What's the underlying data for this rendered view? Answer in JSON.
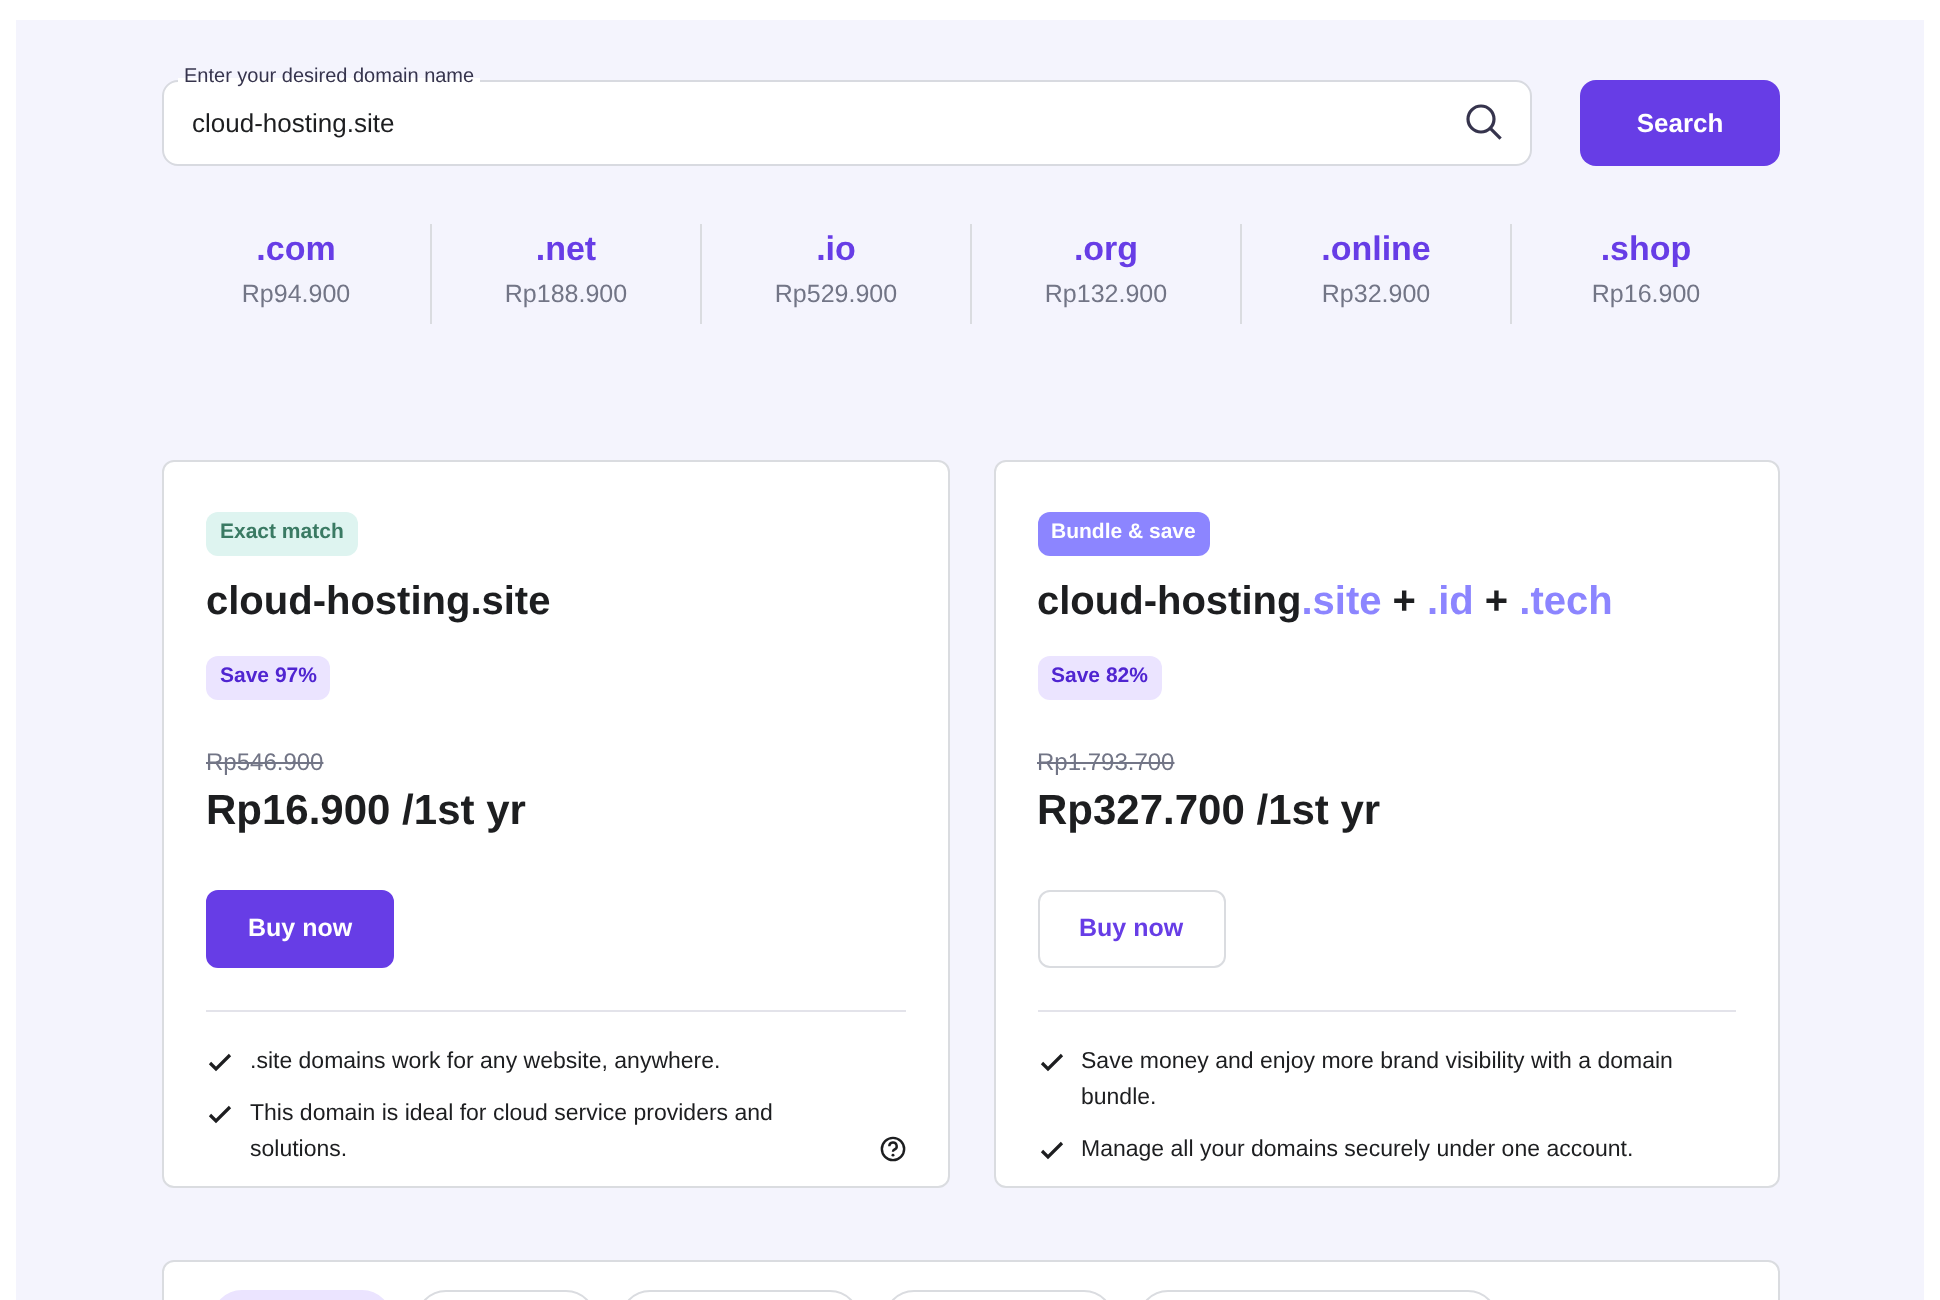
{
  "search": {
    "label": "Enter your desired domain name",
    "value": "cloud-hosting.site",
    "button": "Search"
  },
  "tlds": [
    {
      "name": ".com",
      "price": "Rp94.900"
    },
    {
      "name": ".net",
      "price": "Rp188.900"
    },
    {
      "name": ".io",
      "price": "Rp529.900"
    },
    {
      "name": ".org",
      "price": "Rp132.900"
    },
    {
      "name": ".online",
      "price": "Rp32.900"
    },
    {
      "name": ".shop",
      "price": "Rp16.900"
    }
  ],
  "offers": [
    {
      "badge": {
        "text": "Exact match",
        "kind": "match"
      },
      "title": [
        {
          "text": "cloud-hosting.site",
          "highlighted": false
        }
      ],
      "save": "Save 97%",
      "old_price": "Rp546.900",
      "price": "Rp16.900 /1st yr",
      "button": {
        "label": "Buy now",
        "kind": "primary"
      },
      "features": [
        {
          "text": ".site domains work for any website, anywhere.",
          "help": false
        },
        {
          "text": "This domain is ideal for cloud service providers and solutions.",
          "help": true
        }
      ]
    },
    {
      "badge": {
        "text": "Bundle & save",
        "kind": "bundle"
      },
      "title": [
        {
          "text": "cloud-hosting",
          "highlighted": false
        },
        {
          "text": ".site",
          "highlighted": true
        },
        {
          "text": " + ",
          "highlighted": false
        },
        {
          "text": ".id",
          "highlighted": true
        },
        {
          "text": " + ",
          "highlighted": false
        },
        {
          "text": ".tech",
          "highlighted": true
        }
      ],
      "save": "Save 82%",
      "old_price": "Rp1.793.700",
      "price": "Rp327.700 /1st yr",
      "button": {
        "label": "Buy now",
        "kind": "outline"
      },
      "features": [
        {
          "text": "Save money and enjoy more brand visibility with a domain bundle.",
          "help": false
        },
        {
          "text": "Manage all your domains securely under one account.",
          "help": false
        }
      ]
    }
  ],
  "filter_chips": [
    {
      "selected": true
    },
    {
      "selected": false
    },
    {
      "selected": false
    },
    {
      "selected": false
    },
    {
      "selected": false
    }
  ]
}
